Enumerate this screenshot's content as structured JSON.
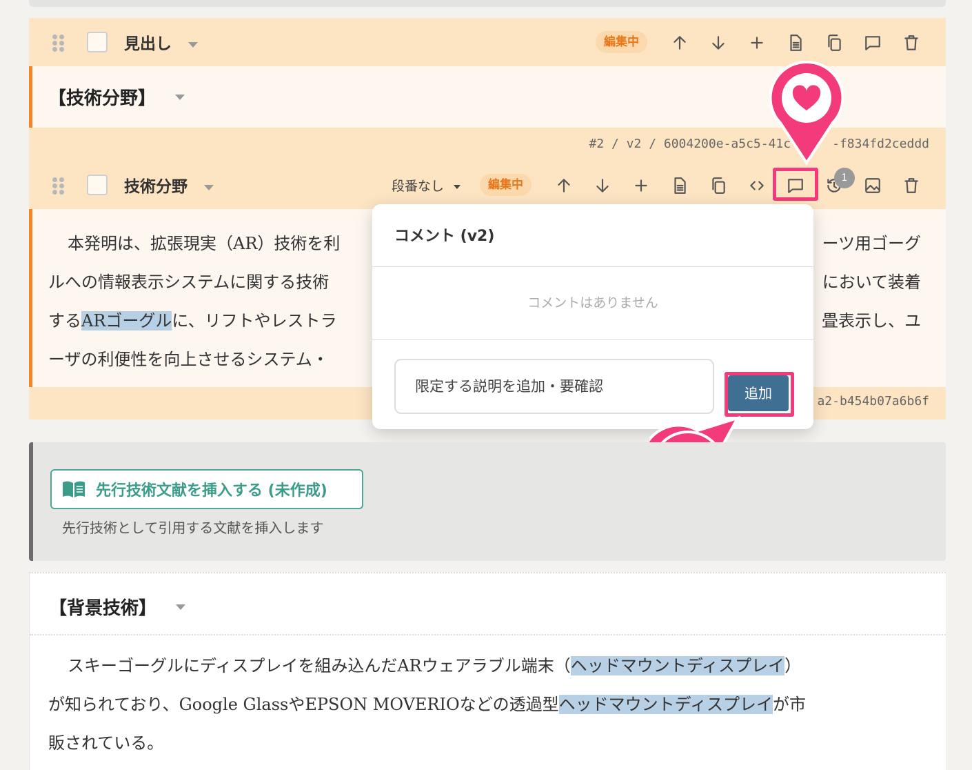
{
  "block1": {
    "title": "見出し",
    "status_badge": "編集中",
    "heading_text": "【技術分野】",
    "meta": "#2 / v2 / 6004200e-a5c5-41c",
    "meta_tail": "-f834fd2ceddd"
  },
  "block2": {
    "title": "技術分野",
    "paragraph_select": "段番なし",
    "status_badge": "編集中",
    "history_count": "1",
    "lines": {
      "l1": "本発明は、拡張現実（AR）技術を利",
      "l1r": "ーツ用ゴーグ",
      "l2": "ルへの情報表示システムに関する技術",
      "l2r": "において装着",
      "l3a": "する",
      "l3hl": "ARゴーグル",
      "l3b": "に、リフトやレストラ",
      "l3r": "畳表示し、ユ",
      "l4": "ーザの利便性を向上させるシステム・"
    },
    "meta_tail": "a2-b454b07a6b6f"
  },
  "comment_popover": {
    "title": "コメント (v2)",
    "empty_text": "コメントはありません",
    "input_value": "限定する説明を追加・要確認",
    "add_button": "追加"
  },
  "insert_block": {
    "button_label": "先行技術文献を挿入する (未作成)",
    "description": "先行技術として引用する文献を挿入します"
  },
  "block3": {
    "heading_text": "【背景技術】",
    "lines": {
      "l1a": "スキーゴーグルにディスプレイを組み込んだARウェアラブル端末（",
      "l1hl": "ヘッドマウントディスプレイ",
      "l1b": "）",
      "l2a": "が知られており、Google GlassやEPSON MOVERIOなどの透過型",
      "l2hl": "ヘッドマウントディスプレイ",
      "l2b": "が市",
      "l3": "販されている。"
    }
  },
  "colors": {
    "accent_orange": "#f0862a",
    "header_bg": "#fde4c3",
    "highlight_pink": "#f33a7a",
    "add_button": "#3f6f93",
    "insert_teal": "#4ea898"
  }
}
